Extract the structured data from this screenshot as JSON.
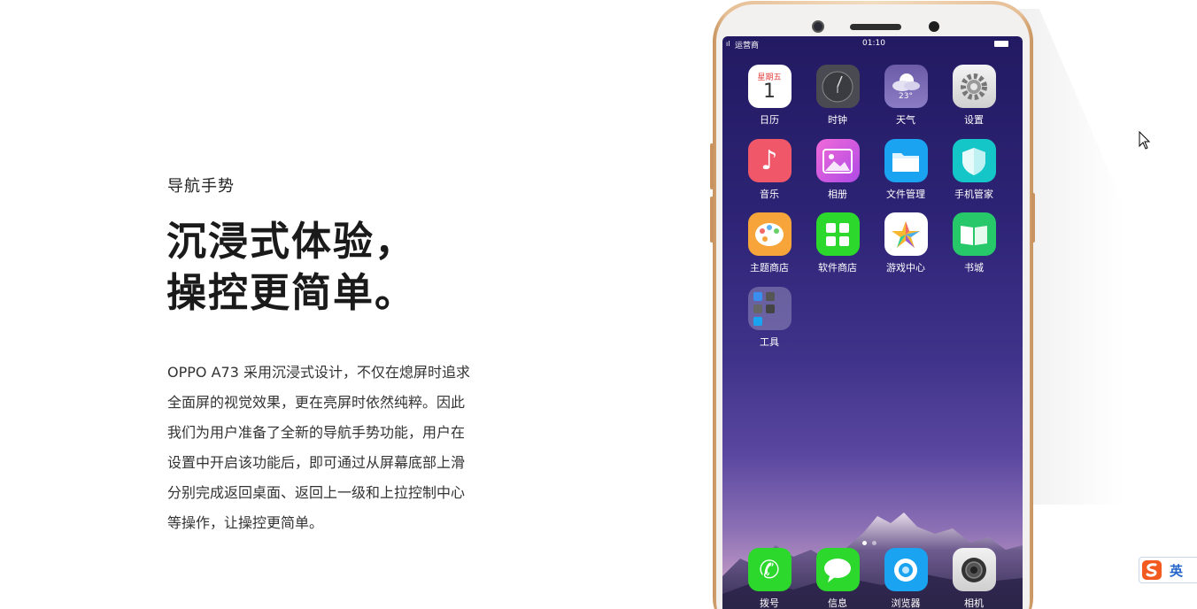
{
  "article": {
    "section_label": "导航手势",
    "headline_line1": "沉浸式体验，",
    "headline_line2": "操控更简单。",
    "body_lines": [
      "OPPO A73 采用沉浸式设计，不仅在熄屏时追求",
      "全面屏的视觉效果，更在亮屏时依然纯粹。因此",
      "我们为用户准备了全新的导航手势功能，用户在",
      "设置中开启该功能后，即可通过从屏幕底部上滑",
      "分别完成返回桌面、返回上一级和上拉控制中心",
      "等操作，让操控更简单。"
    ]
  },
  "phone": {
    "status_bar": {
      "carrier": "运营商",
      "time": "01:10"
    },
    "calendar_icon": {
      "weekday": "星期五",
      "day": "1"
    },
    "weather_icon": {
      "temp": "23°"
    },
    "apps": [
      {
        "label": "日历",
        "icon": "calendar-icon"
      },
      {
        "label": "时钟",
        "icon": "clock-icon"
      },
      {
        "label": "天气",
        "icon": "weather-icon"
      },
      {
        "label": "设置",
        "icon": "settings-gear-icon"
      },
      {
        "label": "音乐",
        "icon": "music-note-icon"
      },
      {
        "label": "相册",
        "icon": "photo-album-icon"
      },
      {
        "label": "文件管理",
        "icon": "folder-icon"
      },
      {
        "label": "手机管家",
        "icon": "shield-icon"
      },
      {
        "label": "主题商店",
        "icon": "palette-icon"
      },
      {
        "label": "软件商店",
        "icon": "app-store-grid-icon"
      },
      {
        "label": "游戏中心",
        "icon": "game-star-icon"
      },
      {
        "label": "书城",
        "icon": "book-icon"
      },
      {
        "label": "工具",
        "icon": "tools-folder-icon"
      }
    ],
    "dock": [
      {
        "label": "拨号",
        "icon": "phone-icon"
      },
      {
        "label": "信息",
        "icon": "message-icon"
      },
      {
        "label": "浏览器",
        "icon": "browser-icon"
      },
      {
        "label": "相机",
        "icon": "camera-icon"
      }
    ],
    "page_indicator": {
      "pages": 2,
      "current": 1
    }
  },
  "ime_toolbar": {
    "lang": "英"
  },
  "colors": {
    "phone_gold": "#e6bf95",
    "screen_top": "#221a62",
    "music_red": "#f0586a",
    "green": "#2bd82b",
    "blue": "#1aa3f0",
    "teal": "#15c6c8"
  }
}
